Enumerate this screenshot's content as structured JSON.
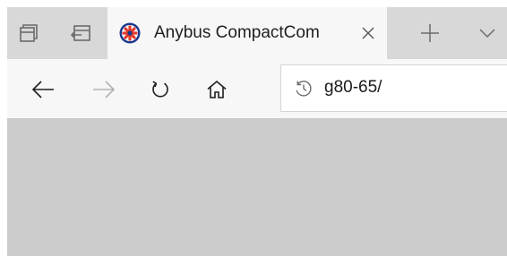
{
  "tabstrip": {
    "active_tab": {
      "title": "Anybus CompactCom",
      "favicon": "anybus-logo-icon",
      "close_icon": "close-icon"
    },
    "icons": {
      "tab_overview": "tab-overview-icon",
      "set_aside": "set-aside-tabs-icon",
      "new_tab": "plus-icon",
      "tab_list": "chevron-down-icon"
    }
  },
  "navbar": {
    "icons": {
      "back": "back-arrow-icon",
      "forward": "forward-arrow-icon",
      "refresh": "refresh-icon",
      "home": "home-icon",
      "history": "history-icon"
    },
    "address": {
      "value": "g80-65/"
    }
  },
  "colors": {
    "tabstrip_background": "#d8d8d8",
    "active_tab_background": "#f7f7f7",
    "toolbar_background": "#f7f7f7",
    "content_background": "#cccccc",
    "favicon_blue": "#1b3a8f",
    "favicon_red": "#e03a2b"
  }
}
